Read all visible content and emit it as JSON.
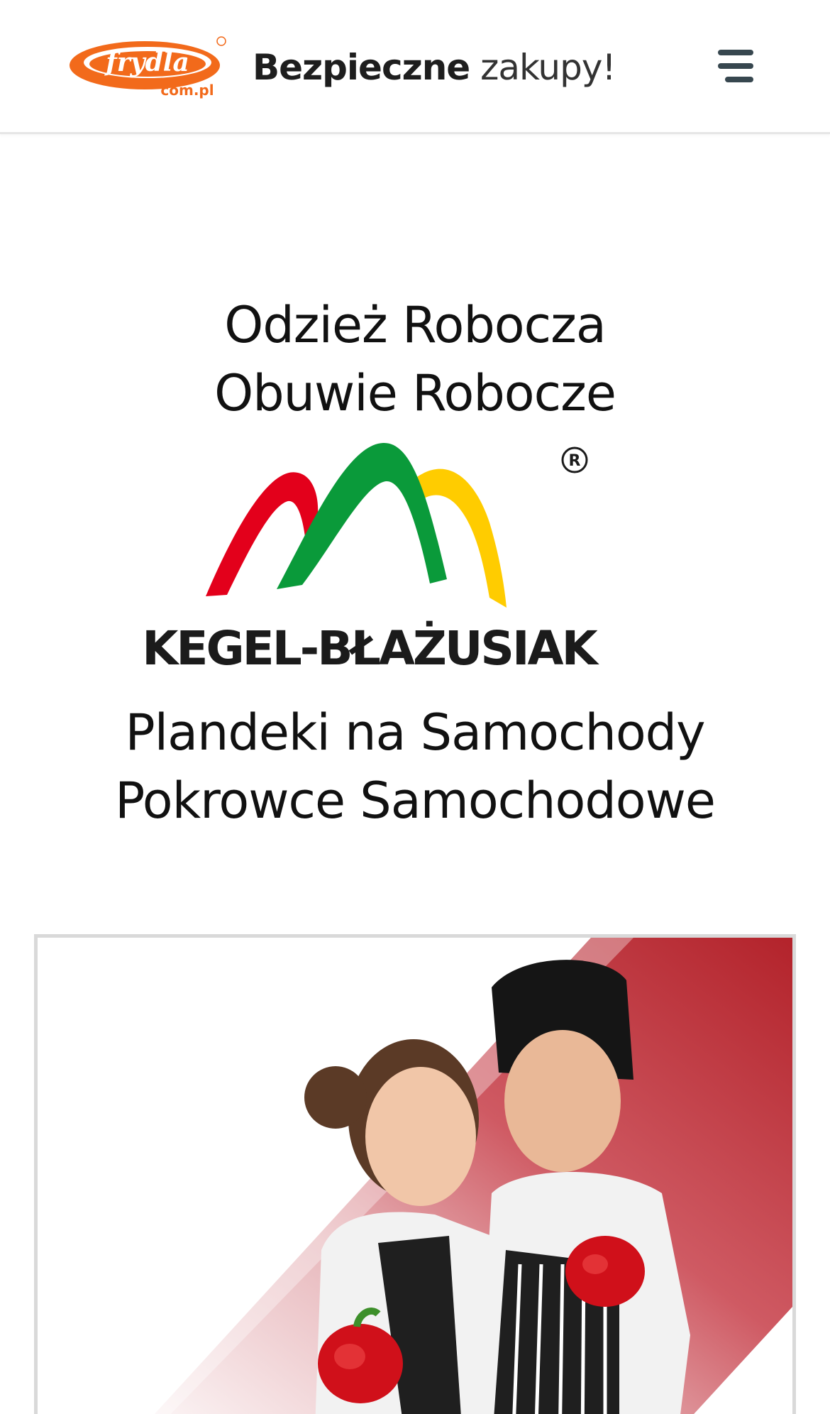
{
  "header": {
    "logo_text": "frydla",
    "logo_domain": "com.pl",
    "tagline_bold": "Bezpieczne",
    "tagline_light": "zakupy!",
    "menu_icon": "hamburger-menu-icon"
  },
  "hero": {
    "line1": "Odzież Robocza",
    "line2": "Obuwie Robocze",
    "brand_name": "KEGEL-BŁAŻUSIAK",
    "registered_mark": "®",
    "line3": "Plandeki na Samochody",
    "line4": "Pokrowce Samochodowe"
  },
  "colors": {
    "logo_orange": "#f26a1b",
    "arch_red": "#e3001b",
    "arch_green": "#0a9a3a",
    "arch_yellow": "#ffcc00",
    "banner_red": "#b3232b",
    "menu_dark": "#37474f"
  }
}
